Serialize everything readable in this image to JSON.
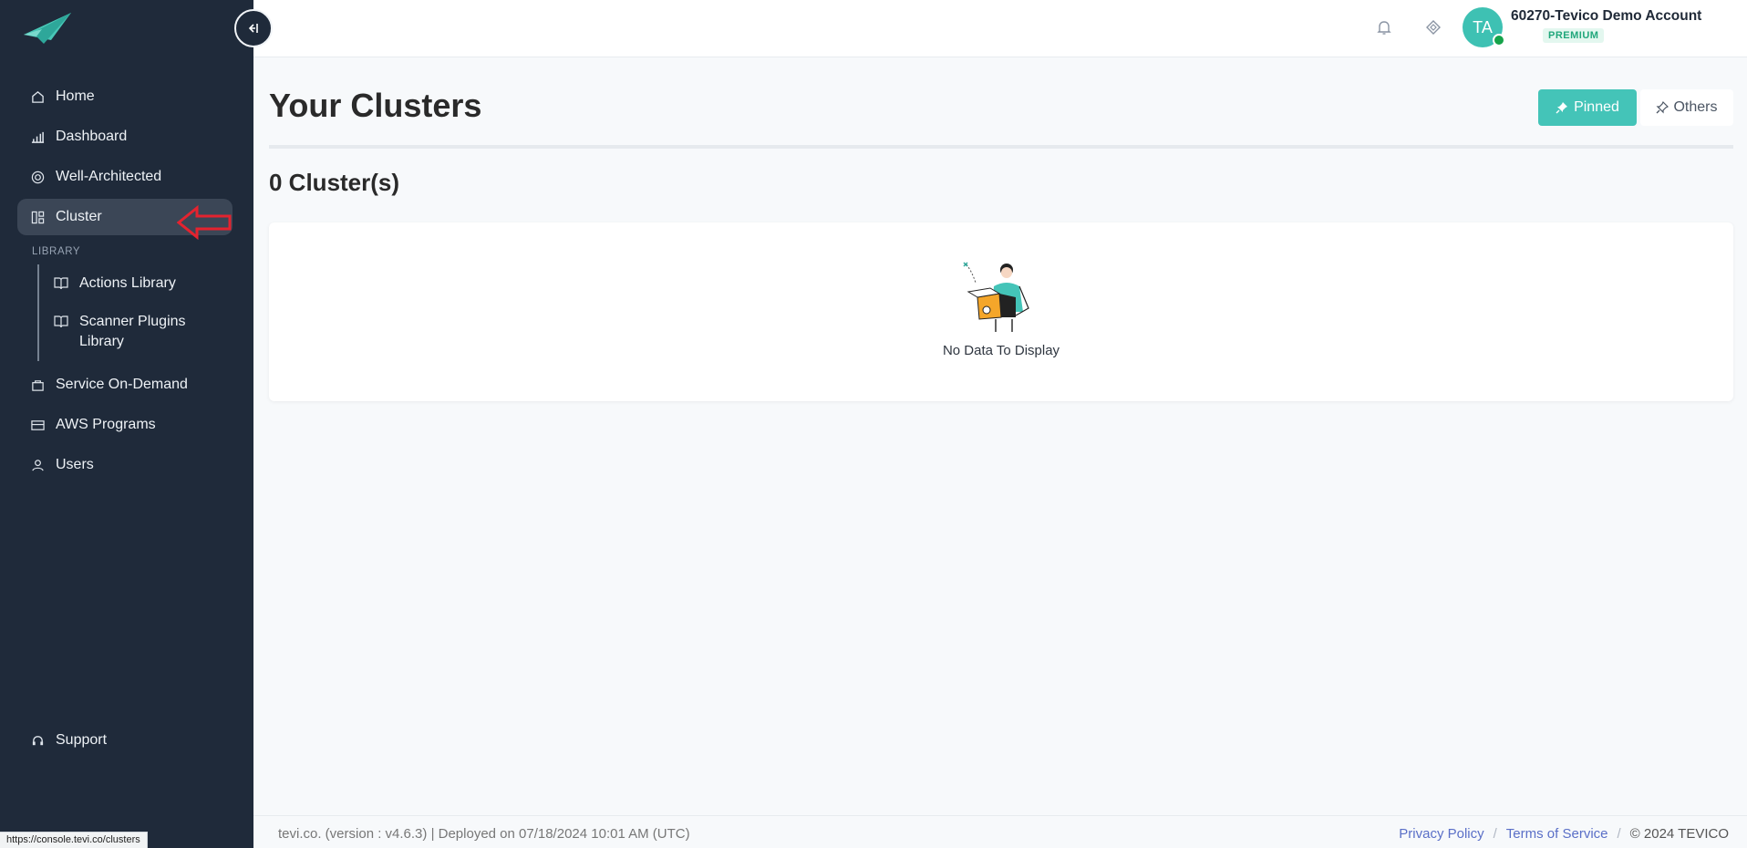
{
  "sidebar": {
    "items": [
      {
        "label": "Home",
        "icon": "home-icon"
      },
      {
        "label": "Dashboard",
        "icon": "bar-chart-icon"
      },
      {
        "label": "Well-Architected",
        "icon": "target-icon"
      },
      {
        "label": "Cluster",
        "icon": "grid-icon",
        "active": true
      }
    ],
    "section_label": "LIBRARY",
    "library_items": [
      {
        "label": "Actions Library",
        "icon": "book-icon"
      },
      {
        "label": "Scanner Plugins Library",
        "icon": "book-icon"
      }
    ],
    "more_items": [
      {
        "label": "Service On-Demand",
        "icon": "bag-icon"
      },
      {
        "label": "AWS Programs",
        "icon": "card-icon"
      },
      {
        "label": "Users",
        "icon": "user-icon"
      }
    ],
    "support_label": "Support"
  },
  "topbar": {
    "avatar_initials": "TA",
    "account_name": "60270-Tevico Demo Account",
    "plan_badge": "PREMIUM"
  },
  "main": {
    "title": "Your Clusters",
    "toggle_pinned": "Pinned",
    "toggle_others": "Others",
    "count_text": "0 Cluster(s)",
    "empty_text": "No Data To Display"
  },
  "footer": {
    "left_text": "tevi.co. (version : v4.6.3) | Deployed on 07/18/2024 10:01 AM (UTC)",
    "privacy": "Privacy Policy",
    "terms": "Terms of Service",
    "copyright": "© 2024 TEVICO"
  },
  "status_url": "https://console.tevi.co/clusters",
  "colors": {
    "accent": "#44c4b8",
    "sidebar_bg": "#1f2a3a",
    "badge": "#20a77b",
    "link": "#5a6fc7"
  }
}
